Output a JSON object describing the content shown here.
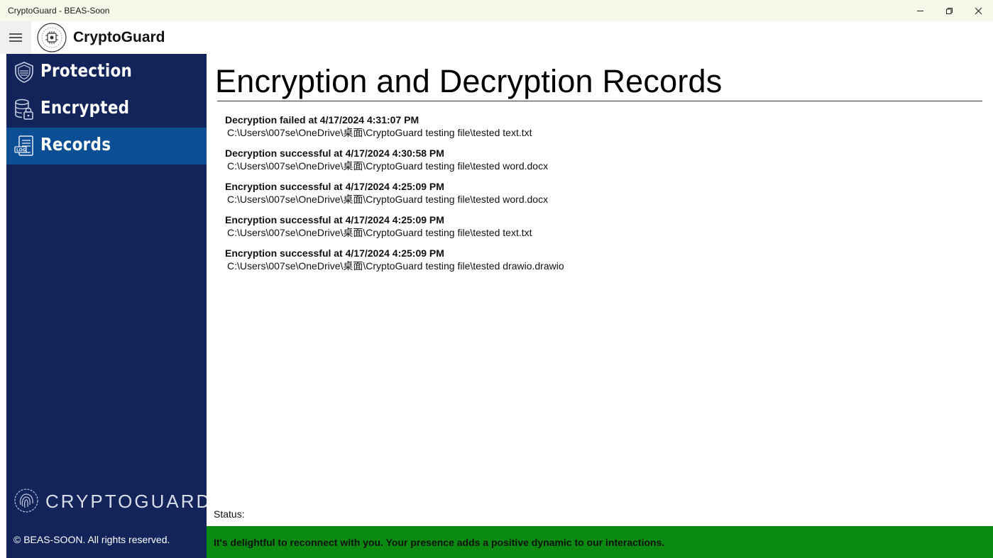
{
  "window": {
    "title": "CryptoGuard - BEAS-Soon",
    "controls": [
      "minimize-icon",
      "restore-icon",
      "close-icon"
    ]
  },
  "header": {
    "app_name": "CryptoGuard",
    "logo_icon": "cryptoguard-logo-icon",
    "menu_icon": "hamburger-icon"
  },
  "sidebar": {
    "items": [
      {
        "label": "Protection",
        "icon": "shield-icon",
        "active": false
      },
      {
        "label": "Encrypted",
        "icon": "database-lock-icon",
        "active": false
      },
      {
        "label": "Records",
        "icon": "log-document-icon",
        "active": true
      }
    ],
    "brand_text": "CRYPTOGUARD",
    "copyright": "© BEAS-SOON. All rights reserved."
  },
  "main": {
    "title": "Encryption and Decryption Records",
    "records": [
      {
        "title": "Decryption failed at 4/17/2024 4:31:07 PM",
        "path": "C:\\Users\\007se\\OneDrive\\桌面\\CryptoGuard testing file\\tested text.txt"
      },
      {
        "title": "Decryption successful at 4/17/2024 4:30:58 PM",
        "path": "C:\\Users\\007se\\OneDrive\\桌面\\CryptoGuard testing file\\tested word.docx"
      },
      {
        "title": "Encryption successful at 4/17/2024 4:25:09 PM",
        "path": "C:\\Users\\007se\\OneDrive\\桌面\\CryptoGuard testing file\\tested word.docx"
      },
      {
        "title": "Encryption successful at 4/17/2024 4:25:09 PM",
        "path": "C:\\Users\\007se\\OneDrive\\桌面\\CryptoGuard testing file\\tested text.txt"
      },
      {
        "title": "Encryption successful at 4/17/2024 4:25:09 PM",
        "path": "C:\\Users\\007se\\OneDrive\\桌面\\CryptoGuard testing file\\tested drawio.drawio"
      }
    ],
    "status_label": "Status:",
    "status_message": "It's delightful to reconnect with you. Your presence adds a positive dynamic to our interactions."
  },
  "colors": {
    "sidebar_bg": "#12245a",
    "sidebar_active": "#0b4e93",
    "status_bar": "#0a8a10",
    "titlebar_bg": "#f7f8ea"
  }
}
